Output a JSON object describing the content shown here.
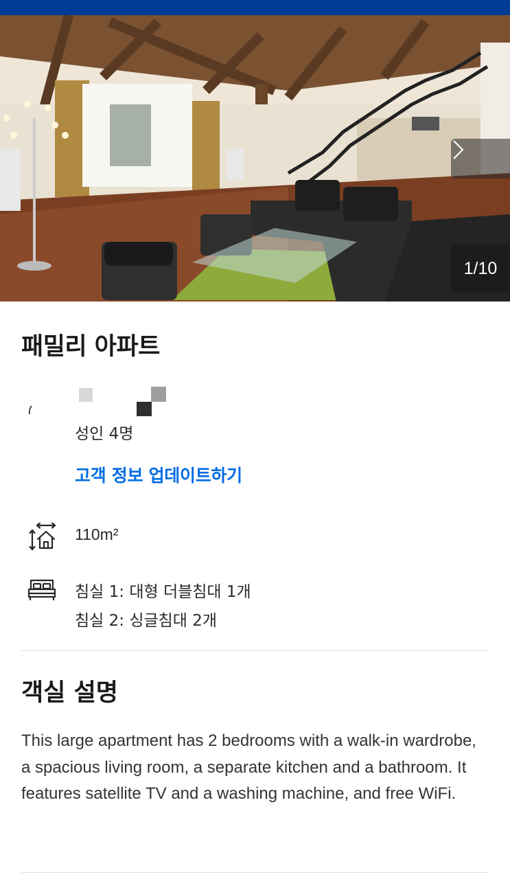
{
  "gallery": {
    "counter": "1/10",
    "next_icon": "chevron-right-icon"
  },
  "property": {
    "title": "패밀리 아파트"
  },
  "occupancy": {
    "guests": "성인 4명",
    "update_link": "고객 정보 업데이트하기"
  },
  "room_size": {
    "icon": "room-size-icon",
    "text": "110m²"
  },
  "beds": {
    "icon": "bed-icon",
    "line1": "침실 1: 대형 더블침대 1개",
    "line2": "침실 2: 싱글침대 2개"
  },
  "description": {
    "heading": "객실 설명",
    "body": "This large apartment has 2 bedrooms with a walk-in wardrobe, a spacious living room, a separate kitchen and a bathroom. It features satellite TV and a washing machine, and free WiFi."
  },
  "colors": {
    "header_blue": "#003b95",
    "link_blue": "#006ce4"
  }
}
